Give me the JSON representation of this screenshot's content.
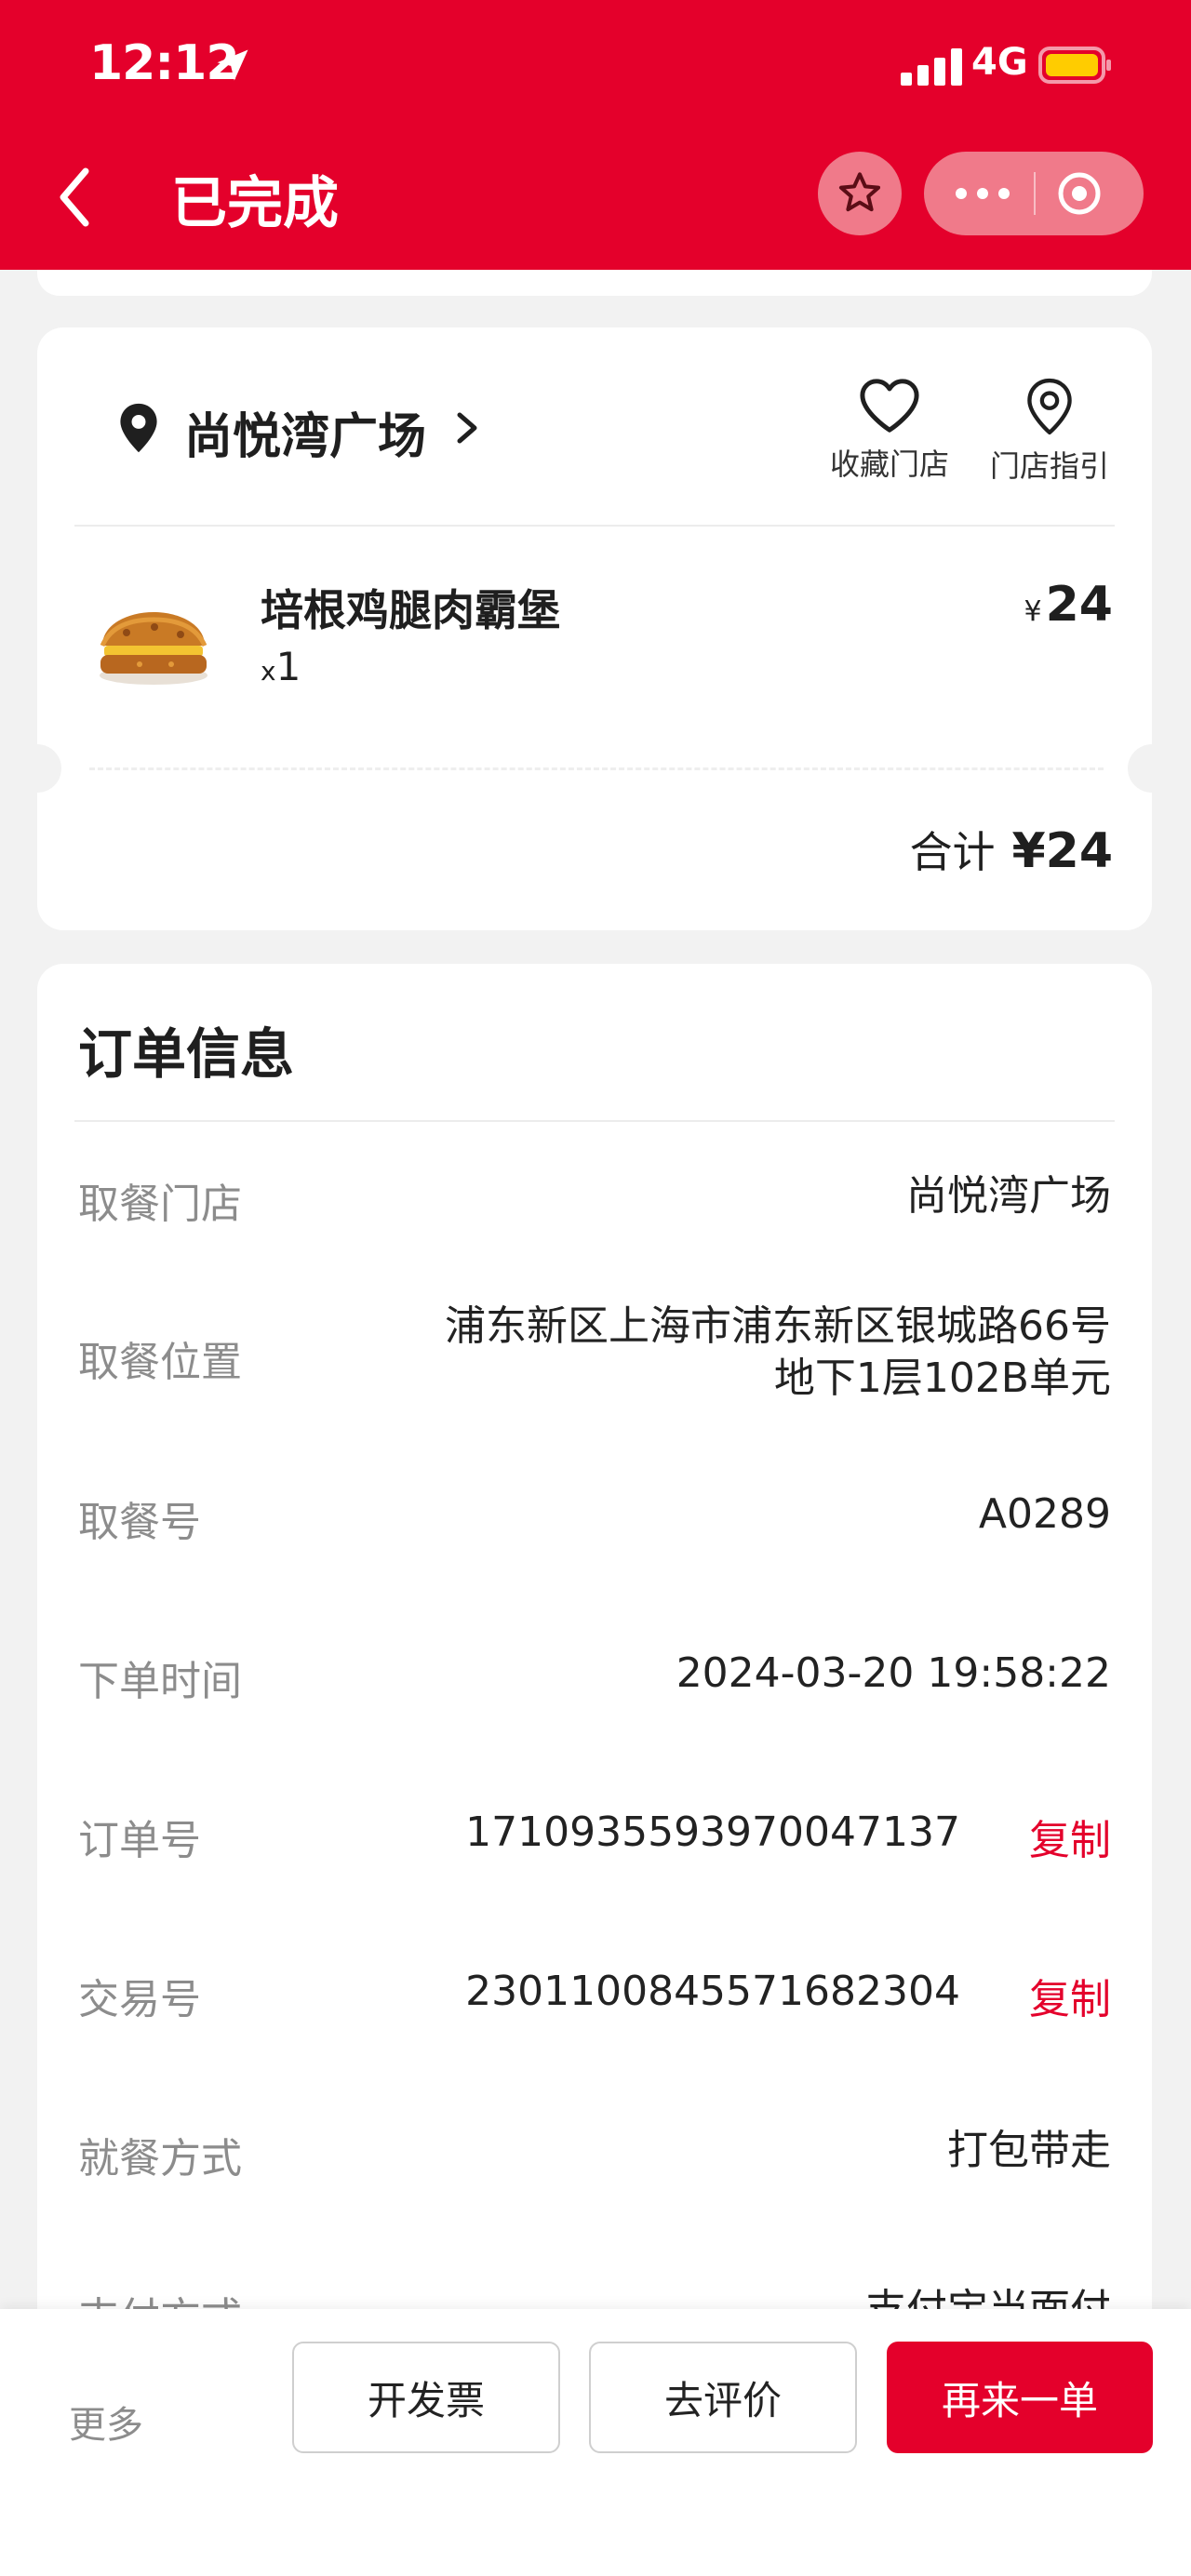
{
  "status_bar": {
    "time": "12:12",
    "network": "4G"
  },
  "header": {
    "title": "已完成"
  },
  "store": {
    "name": "尚悦湾广场",
    "actions": {
      "collect_label": "收藏门店",
      "guide_label": "门店指引"
    }
  },
  "order_item": {
    "name": "培根鸡腿肉霸堡",
    "qty_prefix": "x",
    "qty": "1",
    "currency": "¥",
    "price": "24"
  },
  "total": {
    "label": "合计",
    "amount": "¥24"
  },
  "info": {
    "title": "订单信息",
    "rows": [
      {
        "label": "取餐门店",
        "value": "尚悦湾广场"
      },
      {
        "label": "取餐位置",
        "value_line1": "浦东新区上海市浦东新区银城路66号",
        "value_line2": "地下1层102B单元"
      },
      {
        "label": "取餐号",
        "value": "A0289"
      },
      {
        "label": "下单时间",
        "value": "2024-03-20 19:58:22"
      },
      {
        "label": "订单号",
        "value": "1710935593970047137",
        "action": "复制"
      },
      {
        "label": "交易号",
        "value": "2301100845571682304",
        "action": "复制"
      },
      {
        "label": "就餐方式",
        "value": "打包带走"
      },
      {
        "label": "支付方式",
        "value": "支付宝当面付"
      }
    ]
  },
  "bottom_bar": {
    "more_label": "更多",
    "invoice_label": "开发票",
    "review_label": "去评价",
    "reorder_label": "再来一单"
  },
  "colors": {
    "brand_red": "#e4002b",
    "label_gray": "#8c8c8c",
    "background": "#f2f2f2"
  },
  "icons": [
    "location-arrow-icon",
    "signal-icon",
    "battery-icon",
    "back-icon",
    "star-icon",
    "more-dots-icon",
    "close-circle-icon",
    "location-pin-icon",
    "chevron-right-icon",
    "heart-icon",
    "map-pin-icon"
  ]
}
